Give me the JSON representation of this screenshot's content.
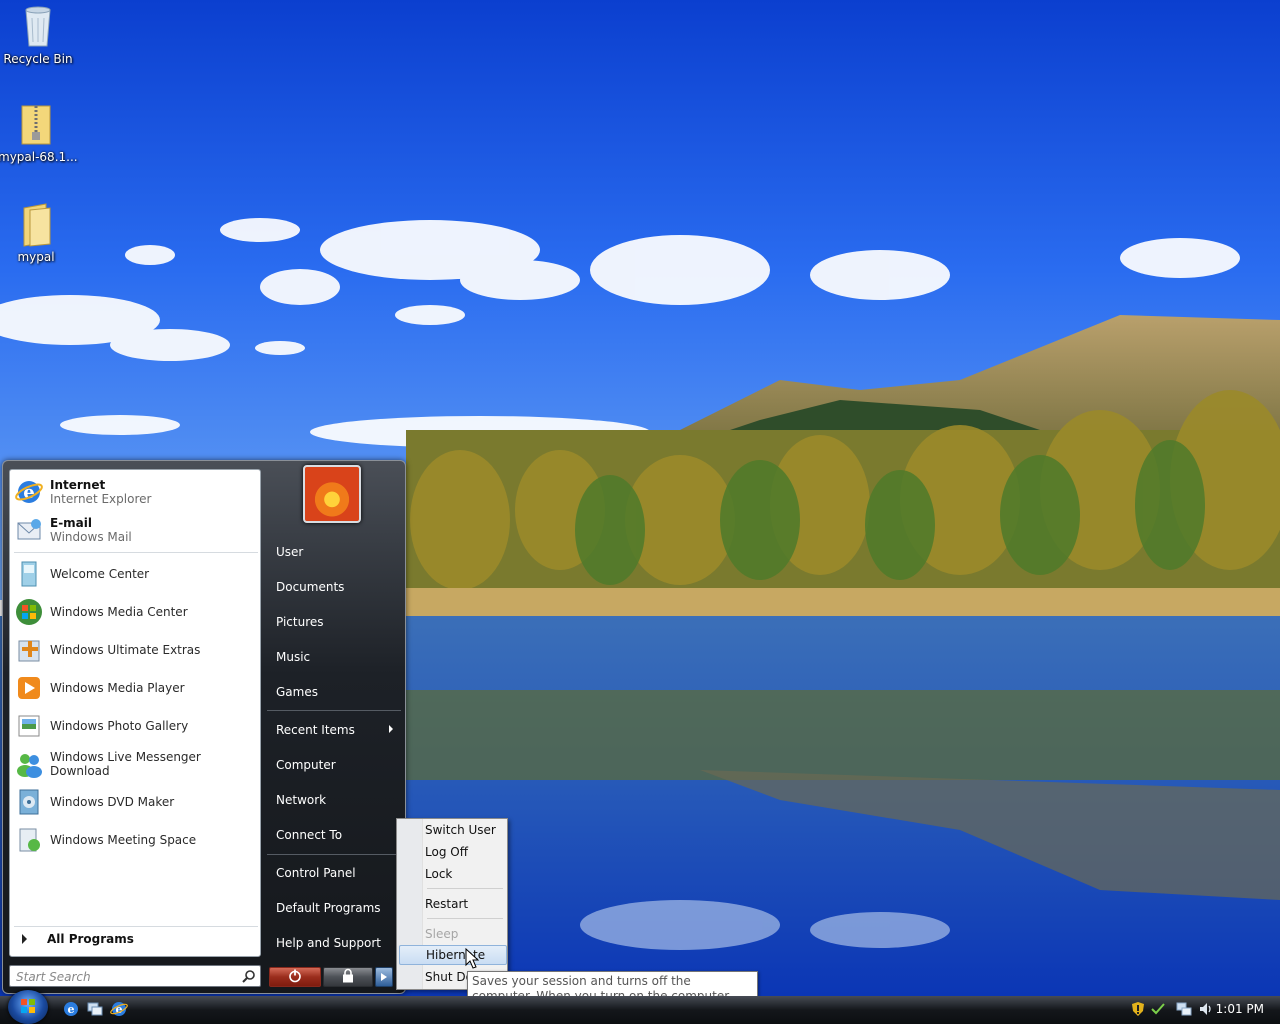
{
  "desktop": {
    "icons": [
      {
        "label": "Recycle Bin",
        "icon": "recycle-bin-icon"
      },
      {
        "label": "mypal-68.1...",
        "icon": "zip-folder-icon"
      },
      {
        "label": "mypal",
        "icon": "folder-icon"
      }
    ]
  },
  "start_menu": {
    "pinned": [
      {
        "title": "Internet",
        "subtitle": "Internet Explorer",
        "icon": "internet-explorer-icon"
      },
      {
        "title": "E-mail",
        "subtitle": "Windows Mail",
        "icon": "windows-mail-icon"
      }
    ],
    "programs": [
      {
        "label": "Welcome Center",
        "icon": "welcome-center-icon"
      },
      {
        "label": "Windows Media Center",
        "icon": "media-center-icon"
      },
      {
        "label": "Windows Ultimate Extras",
        "icon": "ultimate-extras-icon"
      },
      {
        "label": "Windows Media Player",
        "icon": "media-player-icon"
      },
      {
        "label": "Windows Photo Gallery",
        "icon": "photo-gallery-icon"
      },
      {
        "label": "Windows Live Messenger Download",
        "icon": "messenger-icon"
      },
      {
        "label": "Windows DVD Maker",
        "icon": "dvd-maker-icon"
      },
      {
        "label": "Windows Meeting Space",
        "icon": "meeting-space-icon"
      }
    ],
    "all_programs": "All Programs",
    "search_placeholder": "Start Search",
    "right_items": [
      {
        "label": "User"
      },
      {
        "label": "Documents"
      },
      {
        "label": "Pictures"
      },
      {
        "label": "Music"
      },
      {
        "label": "Games"
      },
      {
        "label": "Recent Items",
        "submenu": true
      },
      {
        "label": "Computer"
      },
      {
        "label": "Network"
      },
      {
        "label": "Connect To"
      },
      {
        "label": "Control Panel"
      },
      {
        "label": "Default Programs"
      },
      {
        "label": "Help and Support"
      }
    ]
  },
  "power_menu": {
    "items": [
      {
        "label": "Switch User",
        "enabled": true
      },
      {
        "label": "Log Off",
        "enabled": true
      },
      {
        "label": "Lock",
        "enabled": true
      },
      {
        "label": "Restart",
        "enabled": true
      },
      {
        "label": "Sleep",
        "enabled": false
      },
      {
        "label": "Hibernate",
        "enabled": true,
        "highlighted": true
      },
      {
        "label": "Shut Down",
        "enabled": true
      }
    ]
  },
  "tooltip": "Saves your session and turns off the computer. When you turn on the computer, Windows restores your session.",
  "taskbar": {
    "quick_launch": [
      "internet-explorer-icon",
      "switch-windows-icon",
      "internet-explorer-icon"
    ],
    "tray_icons": [
      "shield-warning-icon",
      "network-check-icon",
      "network-icon",
      "volume-icon"
    ],
    "clock": "1:01 PM"
  }
}
